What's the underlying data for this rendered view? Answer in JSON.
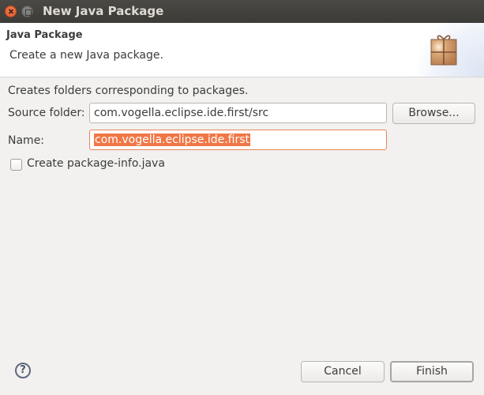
{
  "window": {
    "title": "New Java Package"
  },
  "header": {
    "title": "Java Package",
    "description": "Create a new Java package.",
    "icon": "package-gift-icon"
  },
  "form": {
    "info_text": "Creates folders corresponding to packages.",
    "source_folder": {
      "label": "Source folder:",
      "value": "com.vogella.eclipse.ide.first/src",
      "browse_label": "Browse..."
    },
    "name": {
      "label": "Name:",
      "value": "com.vogella.eclipse.ide.first",
      "selected": true
    },
    "package_info": {
      "label": "Create package-info.java",
      "checked": false
    }
  },
  "footer": {
    "help_icon": "?",
    "cancel_label": "Cancel",
    "finish_label": "Finish"
  },
  "colors": {
    "selection": "#f07746",
    "focus_border": "#e9835a",
    "titlebar": "#3c3b37",
    "close_button": "#e95420"
  }
}
